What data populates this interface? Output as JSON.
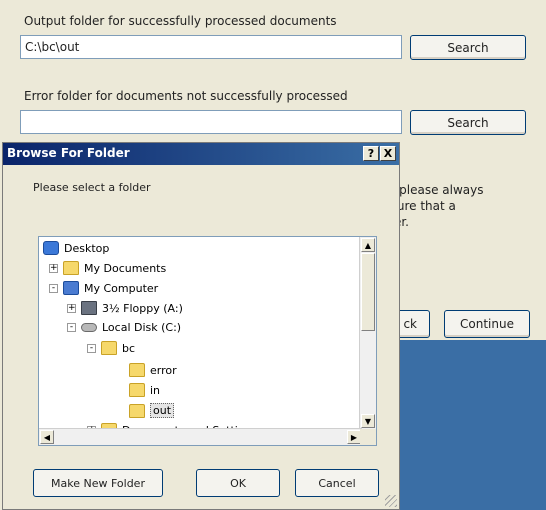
{
  "main": {
    "output_label": "Output folder for successfully processed documents",
    "output_value": "C:\\bc\\out",
    "output_search": "Search",
    "error_label": "Error folder for documents not successfully processed",
    "error_value": "",
    "error_search": "Search",
    "info_line1": "er please always",
    "info_line2": "nsure that a",
    "info_line3": "lder.",
    "back_partial": "ck",
    "continue": "Continue",
    "accent_blue": "#3a6ea5"
  },
  "dialog": {
    "title": "Browse For Folder",
    "help": "?",
    "close": "X",
    "prompt": "Please select a folder",
    "tree": [
      {
        "label": "Desktop",
        "icon": "desktop-icon"
      },
      {
        "label": "My Documents",
        "icon": "folder-icon",
        "expander": "+"
      },
      {
        "label": "My Computer",
        "icon": "computer-icon",
        "expander": "-"
      },
      {
        "label": "3½ Floppy (A:)",
        "icon": "floppy-icon",
        "expander": "+"
      },
      {
        "label": "Local Disk (C:)",
        "icon": "disk-icon",
        "expander": "-"
      },
      {
        "label": "bc",
        "icon": "folder-icon",
        "expander": "-"
      },
      {
        "label": "error",
        "icon": "folder-icon"
      },
      {
        "label": "in",
        "icon": "folder-icon"
      },
      {
        "label": "out",
        "icon": "folder-icon",
        "selected": true
      },
      {
        "label": "Documents and Settings",
        "icon": "folder-icon",
        "expander": "+"
      }
    ],
    "make_new_folder": "Make New Folder",
    "ok": "OK",
    "cancel": "Cancel"
  }
}
